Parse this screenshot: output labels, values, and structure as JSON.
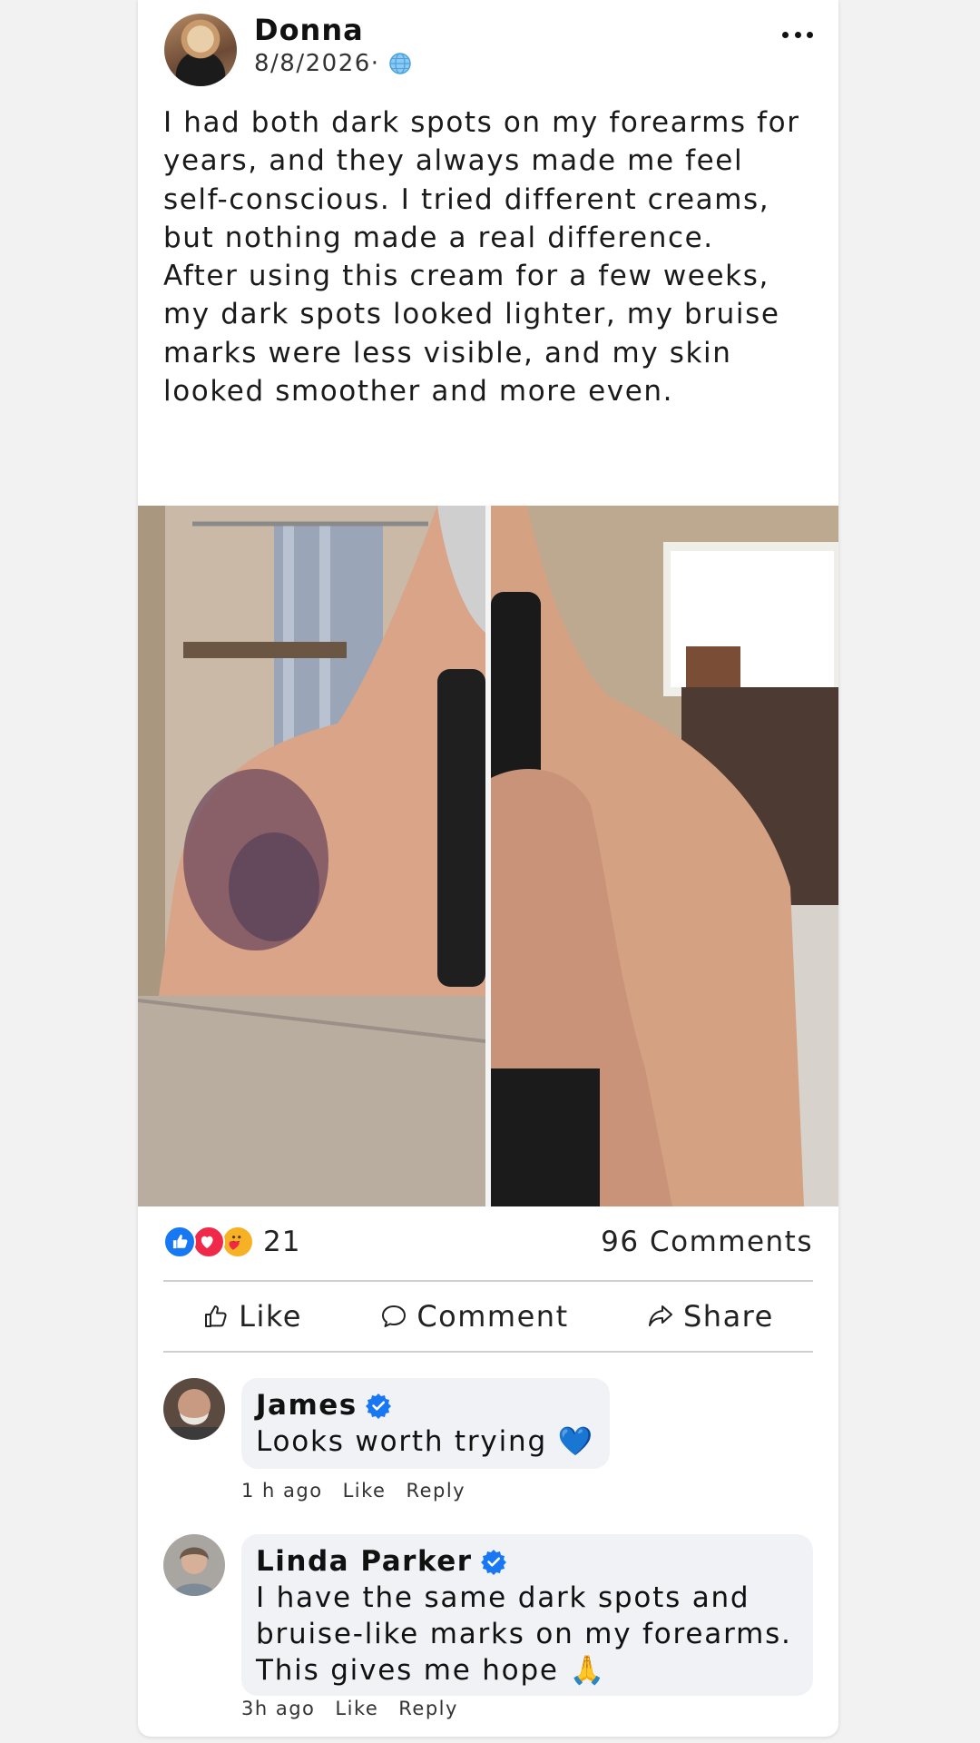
{
  "post": {
    "author": "Donna",
    "date": "8/8/2026·",
    "text_p1": "I had both dark spots on my forearms for years, and they always made me feel self-conscious. I tried different creams, but nothing made a real difference.",
    "text_p2": "After using this cream for a few weeks, my dark spots looked lighter, my bruise marks were less visible, and my skin looked smoother and more even.",
    "reaction_count": "21",
    "comments_count": "96 Comments",
    "reactions": [
      "like-icon",
      "love-icon",
      "care-icon"
    ]
  },
  "actions": {
    "like": "Like",
    "comment": "Comment",
    "share": "Share"
  },
  "comments": [
    {
      "name": "James",
      "text": "Looks worth trying 💙",
      "time": "1 h ago",
      "like": "Like",
      "reply": "Reply"
    },
    {
      "name": "Linda Parker",
      "text": "I have the same dark spots and bruise-like marks on my forearms. This gives me hope 🙏",
      "time": "3h ago",
      "like": "Like",
      "reply": "Reply"
    }
  ],
  "colors": {
    "like_blue": "#1877f2",
    "love_red": "#f02849",
    "care_yellow": "#f7b125",
    "verified_blue": "#1877f2",
    "bubble_bg": "#f0f2f5"
  }
}
